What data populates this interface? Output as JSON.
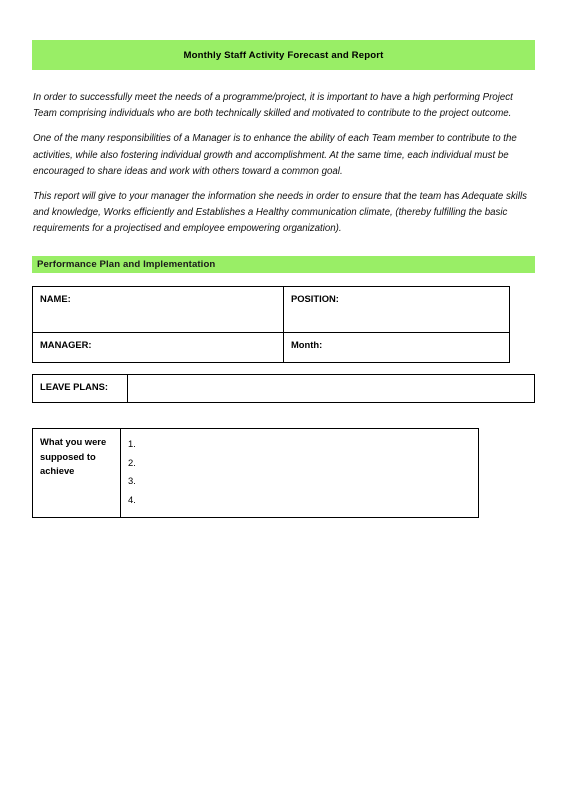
{
  "document": {
    "title_banner": {
      "text": "Monthly Staff Activity Forecast and Report",
      "background_color": "#99ee66"
    },
    "intro_paragraphs": [
      "In order to successfully meet the needs of a programme/project, it is important to have a high performing Project Team comprising individuals who are both technically skilled and motivated to contribute to the project outcome.",
      "One of the many responsibilities of a Manager is to enhance the ability of each Team member to contribute to the activities, while also fostering individual growth and accomplishment. At the same time, each individual must be encouraged to share ideas and work with others toward a common goal.",
      "This report will give to your manager the information she needs in order to ensure that the team has Adequate skills and knowledge, Works efficiently and Establishes a Healthy communication climate, (thereby fulfilling the basic requirements for a projectised and employee empowering organization)."
    ],
    "section_header": {
      "text": "Performance Plan and Implementation",
      "background_color": "#99ee66"
    },
    "info_table": {
      "rows": [
        {
          "left_label": "NAME:",
          "left_value": "",
          "right_label": "POSITION:",
          "right_value": ""
        },
        {
          "left_label": "MANAGER:",
          "left_value": "",
          "right_label": "Month:",
          "right_value": ""
        }
      ]
    },
    "leave_plans": {
      "label": "LEAVE PLANS:",
      "value": ""
    },
    "achievements_table": {
      "label": "What you were supposed to achieve",
      "items": [
        "1.",
        "2.",
        "3.",
        "4."
      ]
    }
  }
}
